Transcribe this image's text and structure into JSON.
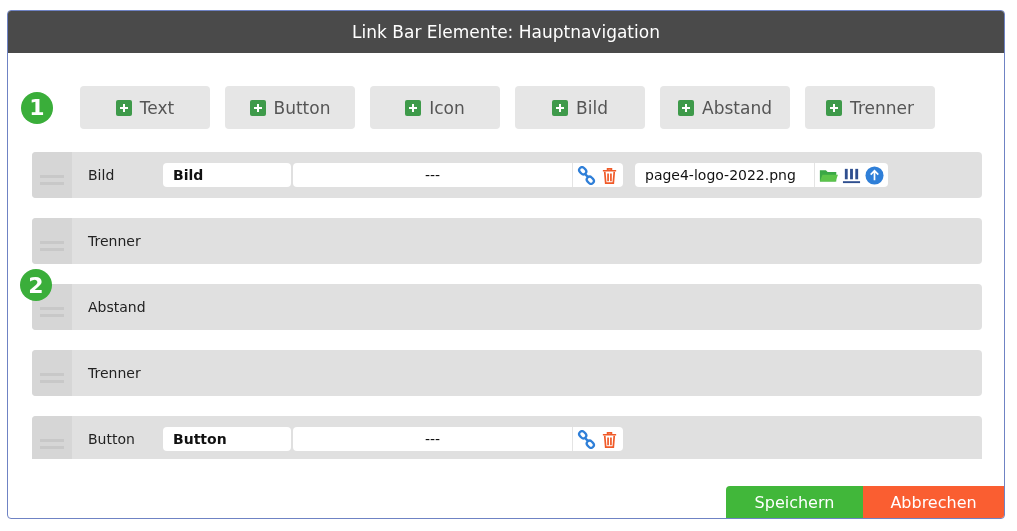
{
  "window": {
    "title": "Link Bar Elemente: Hauptnavigation"
  },
  "markers": [
    "1",
    "2"
  ],
  "add_buttons": [
    {
      "label": "Text"
    },
    {
      "label": "Button"
    },
    {
      "label": "Icon"
    },
    {
      "label": "Bild"
    },
    {
      "label": "Abstand"
    },
    {
      "label": "Trenner"
    }
  ],
  "elements": [
    {
      "kind": "image",
      "label": "Bild",
      "name_value": "Bild",
      "link_value": "---",
      "file_value": "page4-logo-2022.png"
    },
    {
      "kind": "plain",
      "label": "Trenner"
    },
    {
      "kind": "plain",
      "label": "Abstand"
    },
    {
      "kind": "plain",
      "label": "Trenner"
    },
    {
      "kind": "button",
      "label": "Button",
      "name_value": "Button",
      "link_value": "---"
    }
  ],
  "buttons": {
    "save": "Speichern",
    "cancel": "Abbrechen"
  }
}
